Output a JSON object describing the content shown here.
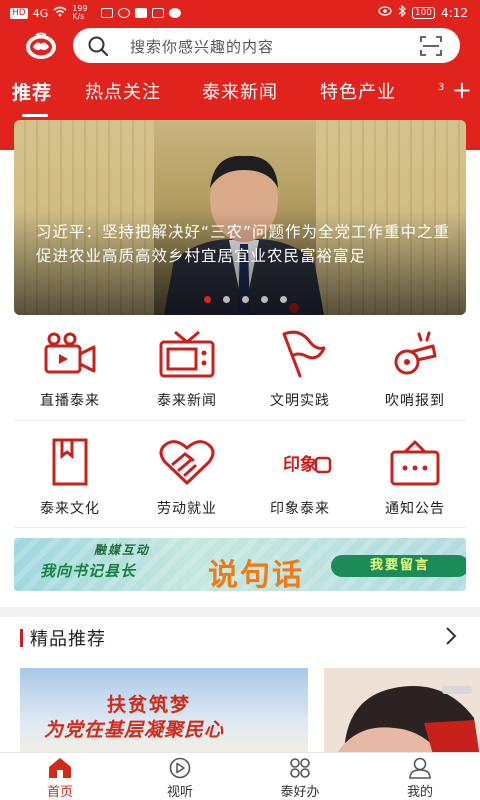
{
  "statusbar": {
    "left_items": [
      "HD",
      "4G",
      "wifi",
      "199 K/s"
    ],
    "battery": "100",
    "time": "4:12"
  },
  "search": {
    "placeholder": "搜索你感兴趣的内容"
  },
  "tabs": [
    {
      "label": "推荐",
      "active": true
    },
    {
      "label": "热点关注"
    },
    {
      "label": "泰来新闻"
    },
    {
      "label": "特色产业"
    },
    {
      "label": "3"
    }
  ],
  "tab_add_label": "+",
  "banner": {
    "caption": "习近平：坚持把解决好“三农”问题作为全党工作重中之重 促进农业高质高效乡村宜居宜业农民富裕富足",
    "slides": 5,
    "active_slide": 1
  },
  "grid": [
    {
      "label": "直播泰来",
      "icon": "camera-icon"
    },
    {
      "label": "泰来新闻",
      "icon": "tv-icon"
    },
    {
      "label": "文明实践",
      "icon": "flag-icon"
    },
    {
      "label": "吹哨报到",
      "icon": "whistle-icon"
    },
    {
      "label": "泰来文化",
      "icon": "book-icon"
    },
    {
      "label": "劳动就业",
      "icon": "heart-hand-icon"
    },
    {
      "label": "印象泰来",
      "icon": "yinxiang-logo-icon",
      "logo_text": "印象"
    },
    {
      "label": "通知公告",
      "icon": "notice-board-icon"
    }
  ],
  "ad": {
    "line1": "融媒互动",
    "line2": "我向书记县长",
    "line3": "说句话",
    "button": "我要留言"
  },
  "section": {
    "title": "精品推荐"
  },
  "card1": {
    "line1": "扶贫筑梦",
    "line2": "为党在基层凝聚民心"
  },
  "bottom_nav": [
    {
      "label": "首页",
      "icon": "home-icon",
      "active": true
    },
    {
      "label": "视听",
      "icon": "play-icon"
    },
    {
      "label": "泰好办",
      "icon": "grid-icon"
    },
    {
      "label": "我的",
      "icon": "user-icon"
    }
  ],
  "colors": {
    "brand_red": "#e0231c",
    "icon_red": "#c8201b"
  }
}
